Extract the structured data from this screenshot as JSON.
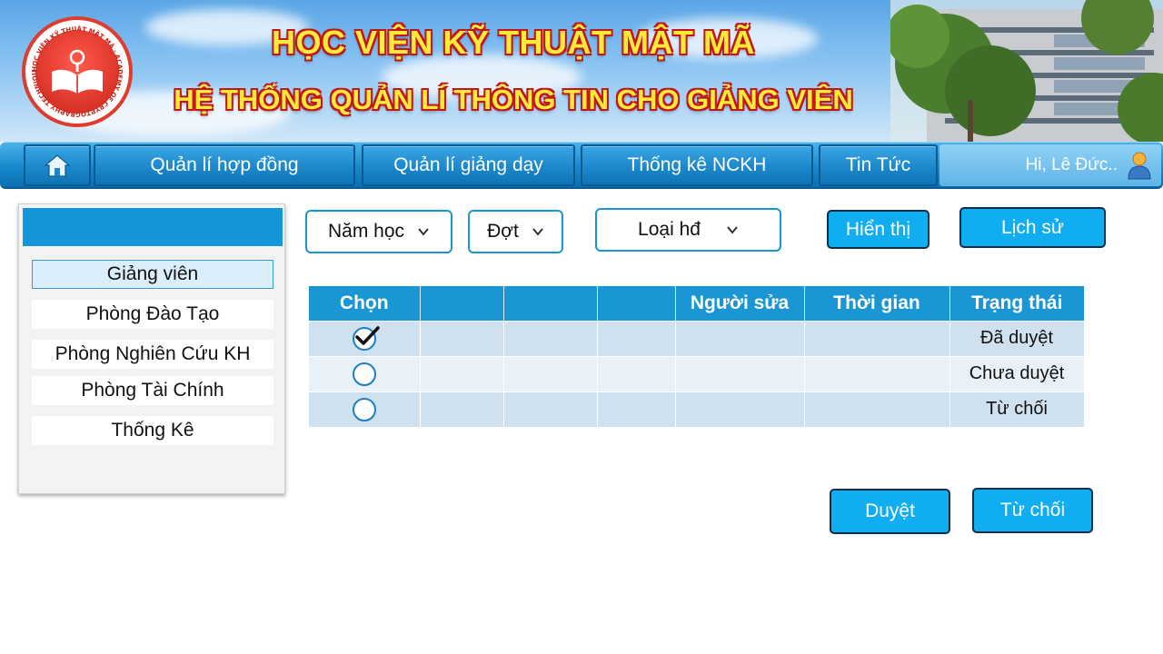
{
  "header": {
    "title": "HỌC VIỆN KỸ THUẬT MẬT MÃ",
    "subtitle": "HỆ THỐNG QUẢN LÍ THÔNG TIN CHO GIẢNG VIÊN",
    "logo_text": "HỌC VIỆN KỸ THUẬT MẬT MÃ · ACADEMY OF CRYPTOGRAPHY TECHNIQUES"
  },
  "nav": {
    "home_icon": "home-icon",
    "items": [
      "Quản lí hợp đồng",
      "Quản lí giảng dạy",
      "Thống kê NCKH",
      "Tin Tức"
    ],
    "user_greeting": "Hi, Lê Đức..",
    "user_icon": "user-avatar-icon"
  },
  "sidebar": {
    "items": [
      "Giảng viên",
      "Phòng Đào Tạo",
      "Phòng Nghiên Cứu KH",
      "Phòng Tài Chính",
      "Thống Kê"
    ],
    "active_index": 0
  },
  "filters": {
    "year": "Năm học",
    "round": "Đợt",
    "contract_type": "Loại hđ",
    "show_button": "Hiển thị",
    "history_button": "Lịch sử"
  },
  "table": {
    "headers": [
      "Chọn",
      "",
      "",
      "",
      "Người sửa",
      "Thời gian",
      "Trạng thái"
    ],
    "rows": [
      {
        "selected": true,
        "status": "Đã duyệt"
      },
      {
        "selected": false,
        "status": "Chưa duyệt"
      },
      {
        "selected": false,
        "status": "Từ chối"
      }
    ]
  },
  "actions": {
    "approve": "Duyệt",
    "reject": "Từ chối"
  },
  "colors": {
    "accent": "#10aef0",
    "nav": "#1689cc",
    "table_header": "#1a96d4",
    "title_text": "#ffe93a",
    "title_outline": "#c0171b"
  }
}
